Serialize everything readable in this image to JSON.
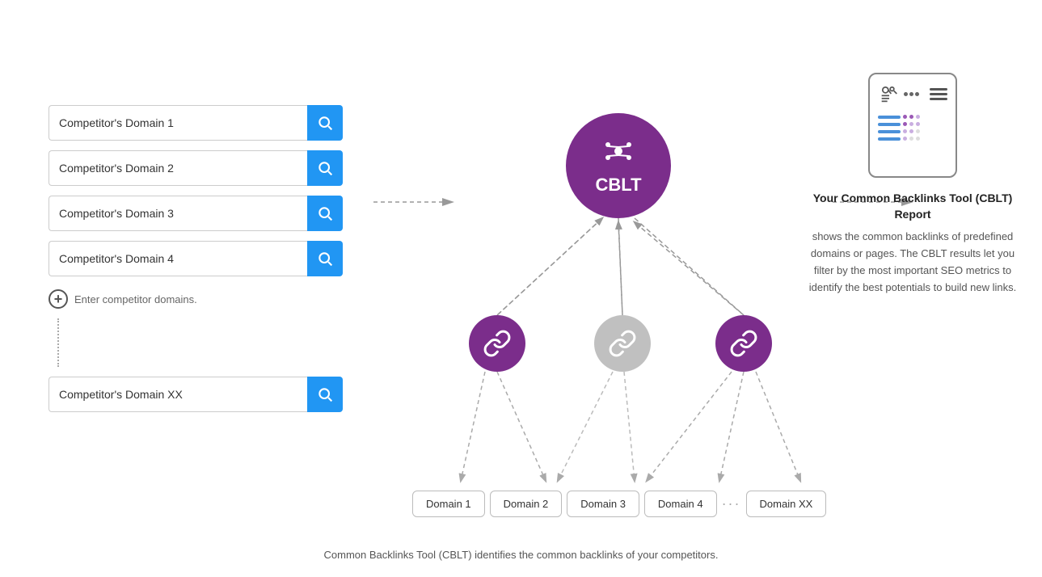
{
  "inputs": [
    {
      "id": 1,
      "value": "Competitor's Domain 1",
      "placeholder": "Competitor's Domain 1"
    },
    {
      "id": 2,
      "value": "Competitor's Domain 2",
      "placeholder": "Competitor's Domain 2"
    },
    {
      "id": 3,
      "value": "Competitor's Domain 3",
      "placeholder": "Competitor's Domain 3"
    },
    {
      "id": 4,
      "value": "Competitor's Domain 4",
      "placeholder": "Competitor's Domain 4"
    },
    {
      "id": "xx",
      "value": "Competitor's Domain XX",
      "placeholder": "Competitor's Domain XX"
    }
  ],
  "add_label": "Enter competitor domains.",
  "cblt_label": "CBLT",
  "link_icon": "🔗",
  "domains": [
    "Domain 1",
    "Domain 2",
    "Domain 3",
    "Domain 4",
    "Domain XX"
  ],
  "right_title": "Your Common Backlinks Tool (CBLT) Report",
  "right_desc": "shows the common backlinks of predefined domains or pages. The CBLT results let you filter by the most important SEO metrics to identify the best potentials to build new links.",
  "bottom_caption": "Common Backlinks Tool (CBLT) identifies the common backlinks of your competitors.",
  "colors": {
    "purple": "#7b2d8b",
    "blue": "#2196f3",
    "gray": "#c0c0c0"
  }
}
